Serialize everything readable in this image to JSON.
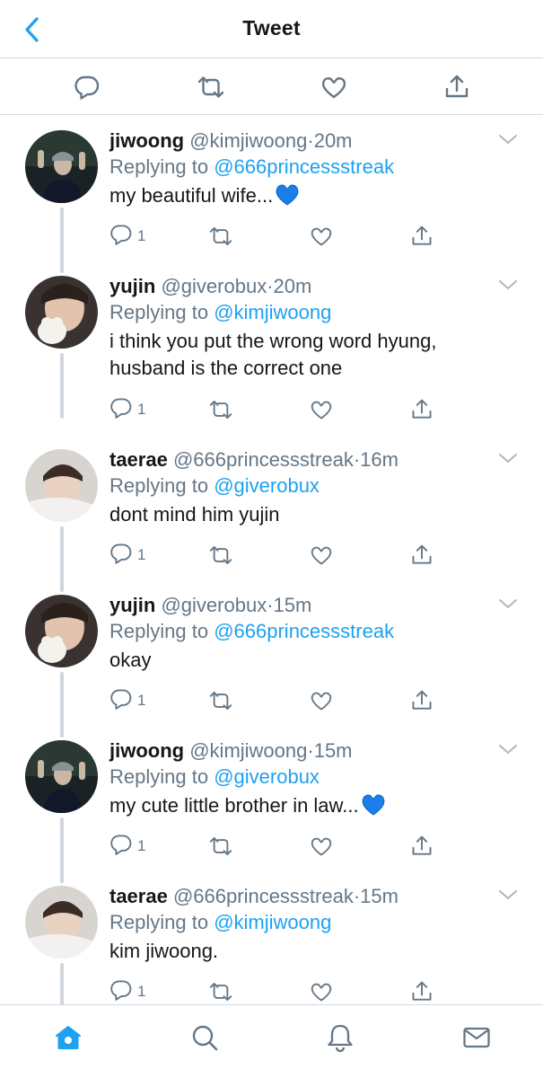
{
  "header": {
    "title": "Tweet",
    "back_icon": "chevron-left-icon"
  },
  "colors": {
    "accent": "#1da1f2",
    "text": "#14171a",
    "muted": "#657786",
    "divider": "#d4d9de",
    "heart_emoji": "#1a7fe8"
  },
  "main_actions": [
    "reply-icon",
    "retweet-icon",
    "like-icon",
    "share-icon"
  ],
  "tweets": [
    {
      "name": "jiwoong",
      "handle": "@kimjiwoong",
      "separator": "·",
      "time": "20m",
      "replying_prefix": "Replying to",
      "replying_to": "@666princessstreak",
      "text": "my beautiful wife...",
      "emoji": "blue-heart",
      "reply_count": "1",
      "avatar": "avatar-jiwoong"
    },
    {
      "name": "yujin",
      "handle": "@giverobux",
      "separator": "·",
      "time": "20m",
      "replying_prefix": "Replying to",
      "replying_to": "@kimjiwoong",
      "text": "i think you put the wrong word hyung, husband is the correct one",
      "emoji": "",
      "reply_count": "1",
      "avatar": "avatar-yujin"
    },
    {
      "name": "taerae",
      "handle": "@666princessstreak",
      "separator": "·",
      "time": "16m",
      "replying_prefix": "Replying to",
      "replying_to": "@giverobux",
      "text": "dont mind him yujin",
      "emoji": "",
      "reply_count": "1",
      "avatar": "avatar-taerae"
    },
    {
      "name": "yujin",
      "handle": "@giverobux",
      "separator": "·",
      "time": "15m",
      "replying_prefix": "Replying to",
      "replying_to": "@666princessstreak",
      "text": "okay",
      "emoji": "",
      "reply_count": "1",
      "avatar": "avatar-yujin"
    },
    {
      "name": "jiwoong",
      "handle": "@kimjiwoong",
      "separator": "·",
      "time": "15m",
      "replying_prefix": "Replying to",
      "replying_to": "@giverobux",
      "text": "my cute little brother in law...",
      "emoji": "blue-heart",
      "reply_count": "1",
      "avatar": "avatar-jiwoong"
    },
    {
      "name": "taerae",
      "handle": "@666princessstreak",
      "separator": "·",
      "time": "15m",
      "replying_prefix": "Replying to",
      "replying_to": "@kimjiwoong",
      "text": "kim jiwoong.",
      "emoji": "",
      "reply_count": "1",
      "avatar": "avatar-taerae"
    }
  ],
  "bottom_nav": [
    "home-icon",
    "search-icon",
    "notifications-icon",
    "messages-icon"
  ],
  "bottom_nav_active": "home-icon"
}
